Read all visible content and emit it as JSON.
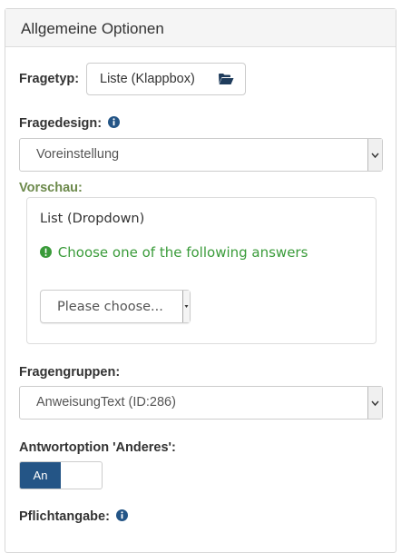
{
  "panel": {
    "heading": "Allgemeine Optionen"
  },
  "question_type": {
    "label": "Fragetyp:",
    "button_label": "Liste (Klappbox)",
    "icon": "folder-open-icon"
  },
  "question_design": {
    "label": "Fragedesign:",
    "info_icon": "info-circle-icon",
    "selected": "Voreinstellung"
  },
  "preview": {
    "label": "Vorschau:",
    "question_title": "List (Dropdown)",
    "hint": "Choose one of the following answers",
    "dropdown_placeholder": "Please choose..."
  },
  "question_groups": {
    "label": "Fragengruppen:",
    "selected": "AnweisungText (ID:286)"
  },
  "other_option": {
    "label": "Antwortoption 'Anderes':",
    "toggle_on_label": "An",
    "state": "on"
  },
  "mandatory": {
    "label": "Pflichtangabe:",
    "info_icon": "info-circle-icon"
  },
  "colors": {
    "accent": "#245586",
    "preview_label": "#6d8a4c",
    "hint_green": "#3a9b3a",
    "info_blue": "#245586"
  }
}
